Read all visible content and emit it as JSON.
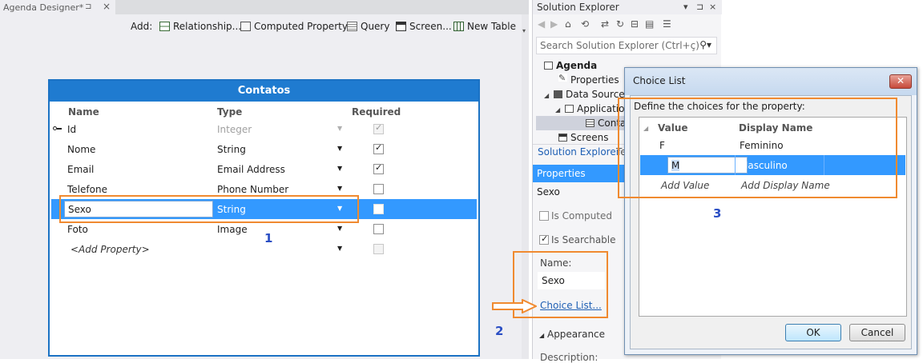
{
  "designer": {
    "tab_title": "Agenda Designer*",
    "toolbar": {
      "add_label": "Add:",
      "relationship": "Relationship...",
      "computed_property": "Computed Property",
      "query": "Query",
      "screen": "Screen...",
      "new_table": "New Table"
    },
    "table": {
      "title": "Contatos",
      "columns": [
        "Name",
        "Type",
        "Required"
      ],
      "rows": [
        {
          "name": "Id",
          "type": "Integer",
          "required": true,
          "key": true
        },
        {
          "name": "Nome",
          "type": "String",
          "required": true
        },
        {
          "name": "Email",
          "type": "Email Address",
          "required": true
        },
        {
          "name": "Telefone",
          "type": "Phone Number",
          "required": false
        },
        {
          "name": "Sexo",
          "type": "String",
          "required": false,
          "selected": true
        },
        {
          "name": "Foto",
          "type": "Image",
          "required": false
        },
        {
          "name": "<Add Property>",
          "type": "",
          "required": false
        }
      ]
    }
  },
  "callouts": {
    "one": "1",
    "two": "2",
    "three": "3"
  },
  "colors": {
    "accent": "#3399ff",
    "table_header": "#1f7bd0",
    "callout": "#f08a30",
    "callout_number": "#2a4ec4"
  },
  "solution_explorer": {
    "title": "Solution Explorer",
    "search_placeholder": "Search Solution Explorer (Ctrl+ç)",
    "tree": [
      {
        "label": "Agenda"
      },
      {
        "label": "Properties"
      },
      {
        "label": "Data Sources"
      },
      {
        "label": "Applicatio"
      },
      {
        "label": "Conta"
      },
      {
        "label": "Screens"
      }
    ],
    "tab_active": "Solution Explorer",
    "tab_other": "Te"
  },
  "properties": {
    "header": "Properties",
    "object_name": "Sexo",
    "is_computed_label": "Is Computed",
    "is_computed": false,
    "is_searchable_label": "Is Searchable",
    "is_searchable": true,
    "name_label": "Name:",
    "name_value": "Sexo",
    "choice_list_link": "Choice List...",
    "appearance": "Appearance",
    "description_label": "Description:"
  },
  "dialog": {
    "title": "Choice List",
    "prompt": "Define the choices for the property:",
    "columns": [
      "Value",
      "Display Name"
    ],
    "rows": [
      {
        "value": "F",
        "display": "Feminino"
      },
      {
        "value": "M",
        "display": "Masculino",
        "selected": true
      }
    ],
    "placeholder_value": "Add Value",
    "placeholder_display": "Add Display Name",
    "ok_label": "OK",
    "cancel_label": "Cancel"
  }
}
